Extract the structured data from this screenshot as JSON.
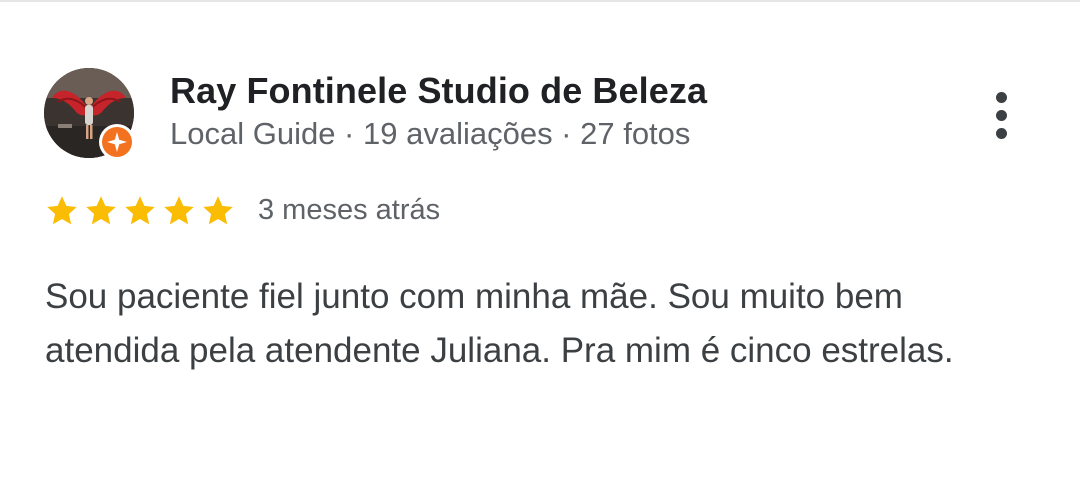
{
  "review": {
    "author": {
      "name": "Ray Fontinele Studio de Beleza",
      "meta": "Local Guide · 19 avaliações · 27 fotos",
      "avatar_icon": "profile-photo",
      "badge_icon": "local-guide-star-icon"
    },
    "rating": {
      "stars": 5,
      "max_stars": 5,
      "star_color": "#fbbc04",
      "time": "3 meses atrás"
    },
    "text": "Sou paciente fiel junto com minha mãe. Sou muito bem atendida pela atendente Juliana. Pra mim é cinco estrelas.",
    "more_icon": "more-vert-icon"
  },
  "colors": {
    "name": "#202124",
    "secondary": "#5f6368",
    "body": "#3c4043",
    "badge": "#f27220"
  }
}
